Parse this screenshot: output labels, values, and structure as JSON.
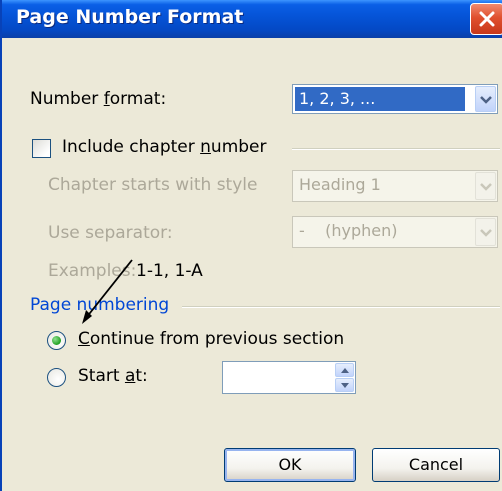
{
  "title": "Page Number Format",
  "number_format": {
    "label_pre": "Number ",
    "label_u": "f",
    "label_post": "ormat:",
    "value": "1, 2, 3, ..."
  },
  "include_chapter": {
    "label_pre": "Include chapter ",
    "label_u": "n",
    "label_post": "umber",
    "checked": false
  },
  "chapter_style": {
    "label": "Chapter starts with style",
    "value": "Heading 1"
  },
  "separator": {
    "label": "Use separator:",
    "value": "-    (hyphen)"
  },
  "examples": {
    "label": "Examples:",
    "value": "1-1, 1-A"
  },
  "page_numbering": {
    "legend": "Page numbering",
    "continue": {
      "label_u": "C",
      "label_post": "ontinue from previous section",
      "selected": true
    },
    "start_at": {
      "label_pre": "Start ",
      "label_u": "a",
      "label_post": "t:",
      "value": "",
      "selected": false
    }
  },
  "buttons": {
    "ok": "OK",
    "cancel": "Cancel"
  },
  "colors": {
    "title_bar": "#0553D6",
    "dialog_bg": "#ECE9D8",
    "selection": "#316AC5",
    "group_label": "#0046D5",
    "disabled_text": "#ACA899"
  },
  "icons": {
    "close": "close-icon",
    "dropdown": "chevron-down-icon",
    "spin_up": "triangle-up-icon",
    "spin_down": "triangle-down-icon",
    "annotation": "arrow-annotation"
  }
}
